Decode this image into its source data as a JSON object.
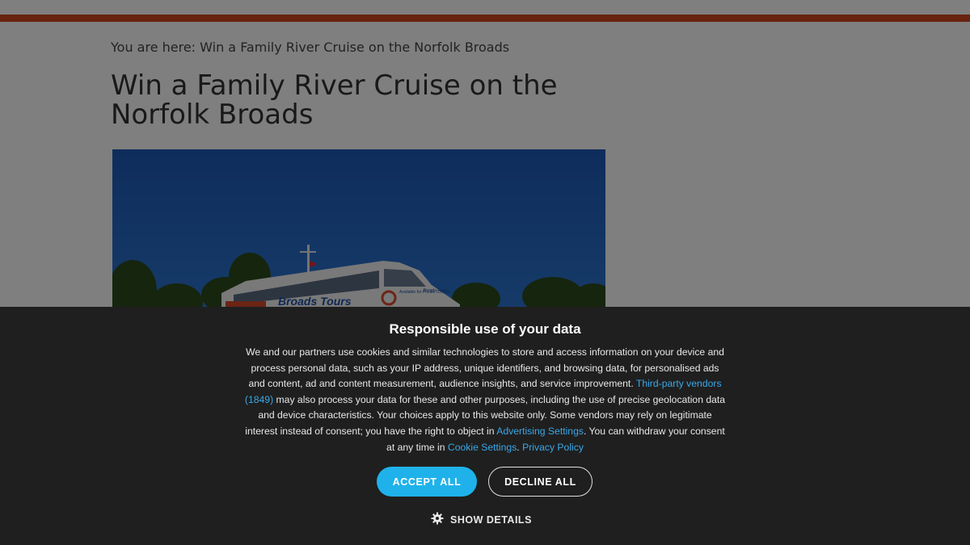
{
  "breadcrumb": "You are here: Win a Family River Cruise on the Norfolk Broads",
  "page_title": "Win a Family River Cruise on the Norfolk Broads",
  "hero": {
    "boat_brand": "Broads Tours",
    "boat_side_text": "Available for Private Charter",
    "boat_side_text_2": "Broads Tours"
  },
  "cookie_banner": {
    "title": "Responsible use of your data",
    "text_1": "We and our partners use cookies and similar technologies to store and access information on your device and process personal data, such as your IP address, unique identifiers, and browsing data, for personalised ads and content, ad and content measurement, audience insights, and service improvement. ",
    "vendors_link": "Third-party vendors (1849)",
    "text_2": " may also process your data for these and other purposes, including the use of precise geolocation data and device characteristics. Your choices apply to this website only. Some vendors may rely on legitimate interest instead of consent; you have the right to object in ",
    "advertising_link": "Advertising Settings",
    "text_3": ". You can withdraw your consent at any time in ",
    "cookie_link": "Cookie Settings",
    "text_4": ". ",
    "privacy_link": "Privacy Policy",
    "accept_label": "ACCEPT ALL",
    "decline_label": "DECLINE ALL",
    "details_label": "SHOW DETAILS",
    "details_icon": "gear-icon"
  },
  "colors": {
    "accent_bar": "#d0451b",
    "banner_bg": "#1f1f1f",
    "accept_bg": "#1fb2ea",
    "link": "#3aa8e8"
  }
}
